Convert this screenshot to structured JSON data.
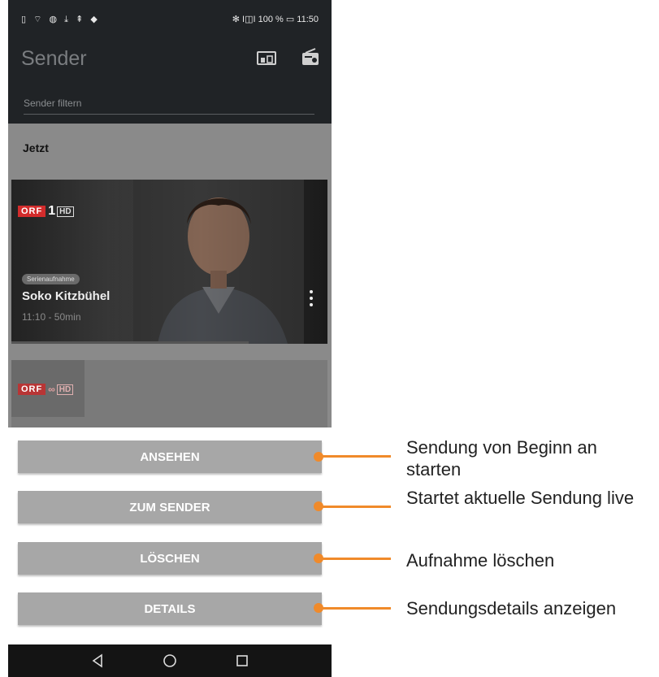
{
  "status_bar": {
    "right_text": "✻ I◫I 100 % ▭ 11:50"
  },
  "app_bar": {
    "title": "Sender",
    "filter_placeholder": "Sender filtern",
    "icons": [
      "cast-icon",
      "radio-icon"
    ]
  },
  "section": {
    "label": "Jetzt"
  },
  "card": {
    "channel_logo": {
      "orf": "ORF",
      "number": "1",
      "hd": "HD"
    },
    "chip": "Serienaufnahme",
    "title": "Soko Kitzbühel",
    "time": "11:10 - 50min",
    "progress_fraction": 0.75
  },
  "card2": {
    "channel_logo": {
      "orf": "ORF",
      "number": "∞",
      "hd": "HD"
    }
  },
  "sheet": {
    "buttons": [
      "ANSEHEN",
      "ZUM SENDER",
      "LÖSCHEN",
      "DETAILS"
    ]
  },
  "nav": {
    "icons": [
      "back-icon",
      "home-icon",
      "recents-icon"
    ]
  },
  "callouts": [
    "Sendung von Beginn an starten",
    "Startet aktuelle Sendung live",
    "Aufnahme löschen",
    "Sendungsdetails anzeigen"
  ],
  "colors": {
    "accent": "#f08a2a",
    "orf_red": "#d32c2c",
    "button_grey": "#a7a7a7"
  }
}
